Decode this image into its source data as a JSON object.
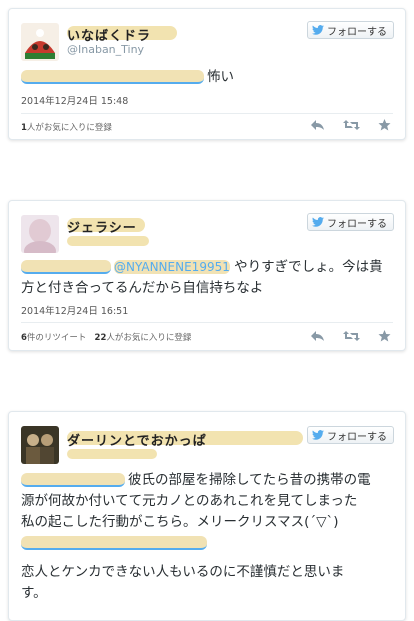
{
  "follow_label": "フォローする",
  "tweets": [
    {
      "name": "いなばくドラ",
      "handle": "@Inaban_Tiny",
      "text": "怖い",
      "date": "2014年12月24日 15:48",
      "stats": {
        "favorites_count": "1",
        "favorites_label": "人がお気に入りに登録"
      }
    },
    {
      "name": "ジェラシー",
      "handle": "",
      "mention_visible": "@NYANNENE19951",
      "text": "やりすぎでしょ。今は貴方と付き合ってるんだから自信持ちなよ",
      "date": "2014年12月24日 16:51",
      "stats": {
        "retweets_count": "6",
        "retweets_label": "件のリツイート",
        "favorites_count": "22",
        "favorites_label": "人がお気に入りに登録"
      }
    },
    {
      "name": "ダーリンとでおかっぱ",
      "handle": "",
      "text_line1": "彼氏の部屋を掃除してたら昔の携帯の電",
      "text_line2": "源が何故か付いてて元カノとのあれこれを見てしまった",
      "text_line3": "私の起こした行動がこちら。メリークリスマス(´▽`)",
      "text_line4": "恋人とケンカできない人もいるのに不謹慎だと思いま",
      "text_line5": "す。"
    }
  ],
  "icons": {
    "reply": "reply-icon",
    "retweet": "retweet-icon",
    "favorite": "star-icon",
    "bird": "twitter-bird-icon"
  },
  "colors": {
    "link": "#55acee",
    "redaction": "#f1e2b4",
    "border": "#e1e8ed"
  }
}
